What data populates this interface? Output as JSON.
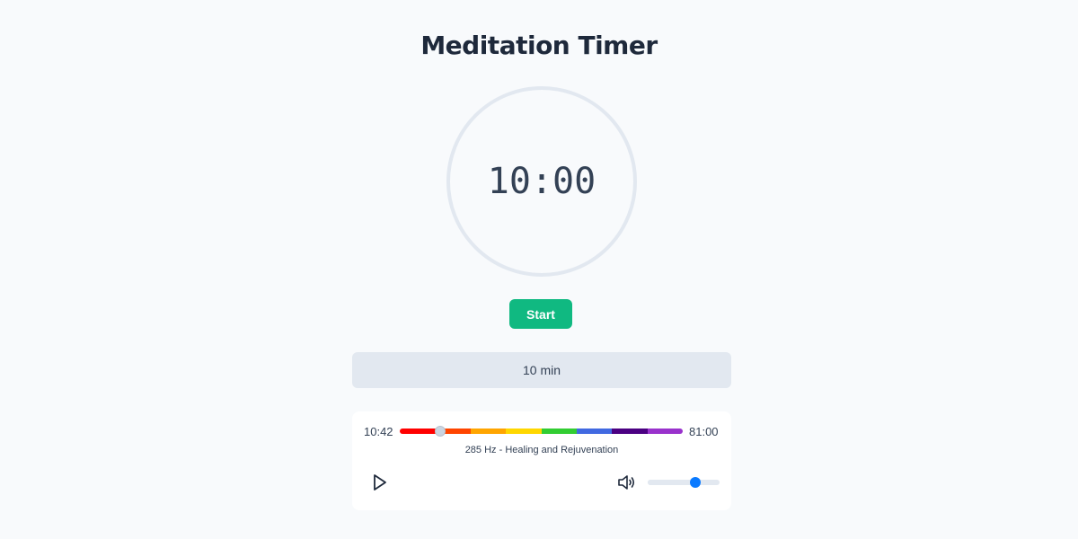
{
  "app": {
    "title": "Meditation Timer"
  },
  "timer": {
    "display": "10:00"
  },
  "controls": {
    "start_label": "Start",
    "duration_label": "10 min"
  },
  "player": {
    "elapsed": "10:42",
    "total": "81:00",
    "progress": 0.142,
    "frequency_label": "285 Hz - Healing and Rejuvenation",
    "volume": 0.66,
    "play_icon": "play-icon",
    "volume_icon": "volume-icon",
    "spectrum_colors": [
      "#ff0000",
      "#ff4500",
      "#ffa500",
      "#ffd700",
      "#32cd32",
      "#4169e1",
      "#4b0082",
      "#9932cc"
    ]
  },
  "colors": {
    "accent": "#10b981",
    "volume_accent": "#0a7aff",
    "ring": "#e2e8f0"
  }
}
